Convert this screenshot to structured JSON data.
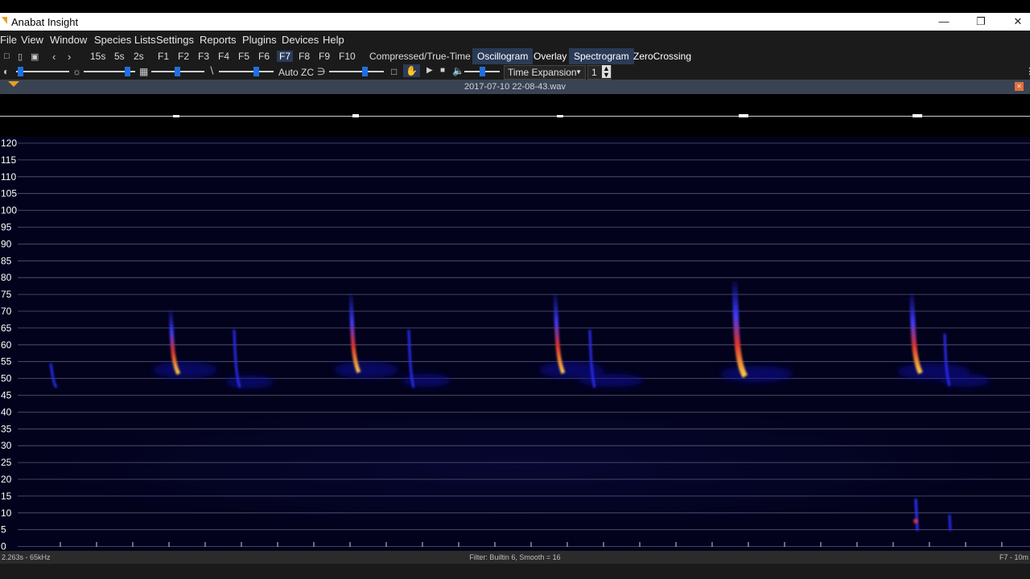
{
  "window": {
    "title": "Anabat Insight"
  },
  "menu": [
    "File",
    "View",
    "Window",
    "Species Lists",
    "Settings",
    "Reports",
    "Plugins",
    "Devices",
    "Help"
  ],
  "toolbar": {
    "time_spans": [
      "15s",
      "5s",
      "2s"
    ],
    "fkeys": [
      "F1",
      "F2",
      "F3",
      "F4",
      "F5",
      "F6",
      "F7",
      "F8",
      "F9",
      "F10"
    ],
    "active_fkey": "F7",
    "mode_label": "Compressed/True-Time",
    "views": [
      {
        "label": "Oscillogram",
        "active": true
      },
      {
        "label": "Overlay",
        "active": false
      },
      {
        "label": "Spectrogram",
        "active": true
      },
      {
        "label": "ZeroCrossing",
        "active": false
      }
    ]
  },
  "controls": {
    "auto_zc_label": "Auto ZC",
    "expansion_mode": "Time Expansion",
    "expansion_factor": "1",
    "sliders": [
      0.07,
      0.84,
      0.48,
      0.67,
      0.65,
      0.5
    ]
  },
  "file": {
    "name": "2017-07-10 22-08-43.wav"
  },
  "status": {
    "left": "2.263s - 65kHz",
    "center": "Filter: Builtin 6, Smooth = 16",
    "right": "F7 - 10m"
  },
  "axis": {
    "labels": [
      "120",
      "115",
      "110",
      "105",
      "100",
      "95",
      "90",
      "85",
      "80",
      "75",
      "70",
      "65",
      "60",
      "55",
      "50",
      "45",
      "40",
      "35",
      "30",
      "25",
      "20",
      "15",
      "10",
      "5",
      "0"
    ]
  },
  "colors": {
    "background": "#000000",
    "spectro_bg": "#02021c",
    "call_core": "#ffd040",
    "call_mid": "#e04020",
    "call_edge": "#2a2aff"
  }
}
